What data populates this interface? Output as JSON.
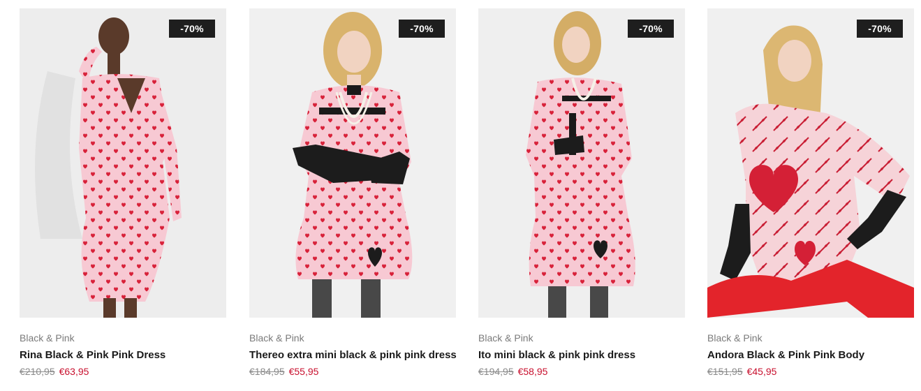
{
  "products": [
    {
      "discount": "-70%",
      "brand": "Black & Pink",
      "name": "Rina Black & Pink Pink Dress",
      "old_price": "€210,95",
      "new_price": "€63,95"
    },
    {
      "discount": "-70%",
      "brand": "Black & Pink",
      "name": "Thereo extra mini black & pink pink dress",
      "old_price": "€184,95",
      "new_price": "€55,95"
    },
    {
      "discount": "-70%",
      "brand": "Black & Pink",
      "name": "Ito mini black & pink pink dress",
      "old_price": "€194,95",
      "new_price": "€58,95"
    },
    {
      "discount": "-70%",
      "brand": "Black & Pink",
      "name": "Andora Black & Pink Pink Body",
      "old_price": "€151,95",
      "new_price": "€45,95"
    }
  ],
  "colors": {
    "badge_bg": "#1e1e1e",
    "sale_price": "#c8102e",
    "dress_pink": "#f7c9d3",
    "heart_red": "#d8223a"
  }
}
